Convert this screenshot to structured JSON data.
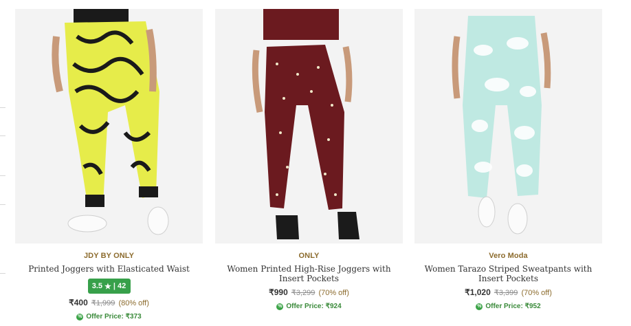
{
  "products": [
    {
      "brand": "JDY BY ONLY",
      "name": "Printed Joggers with Elasticated Waist",
      "rating": {
        "score": "3.5",
        "star": "★",
        "sep": "|",
        "count": "42"
      },
      "price": "₹400",
      "mrp": "₹1,999",
      "discount": "(80% off)",
      "offer_label": "Offer Price: ₹373",
      "image_icon": "yellow-print-joggers-image"
    },
    {
      "brand": "ONLY",
      "name": "Women Printed High-Rise Joggers with Insert Pockets",
      "price": "₹990",
      "mrp": "₹3,299",
      "discount": "(70% off)",
      "offer_label": "Offer Price: ₹924",
      "image_icon": "maroon-print-joggers-image"
    },
    {
      "brand": "Vero Moda",
      "name": "Women Tarazo Striped Sweatpants with Insert Pockets",
      "price": "₹1,020",
      "mrp": "₹3,399",
      "discount": "(70% off)",
      "offer_label": "Offer Price: ₹952",
      "image_icon": "mint-print-sweatpants-image"
    }
  ],
  "colors": {
    "brand": "#8c6b2d",
    "rating_bg": "#37a04a",
    "offer": "#3a8a3a"
  }
}
